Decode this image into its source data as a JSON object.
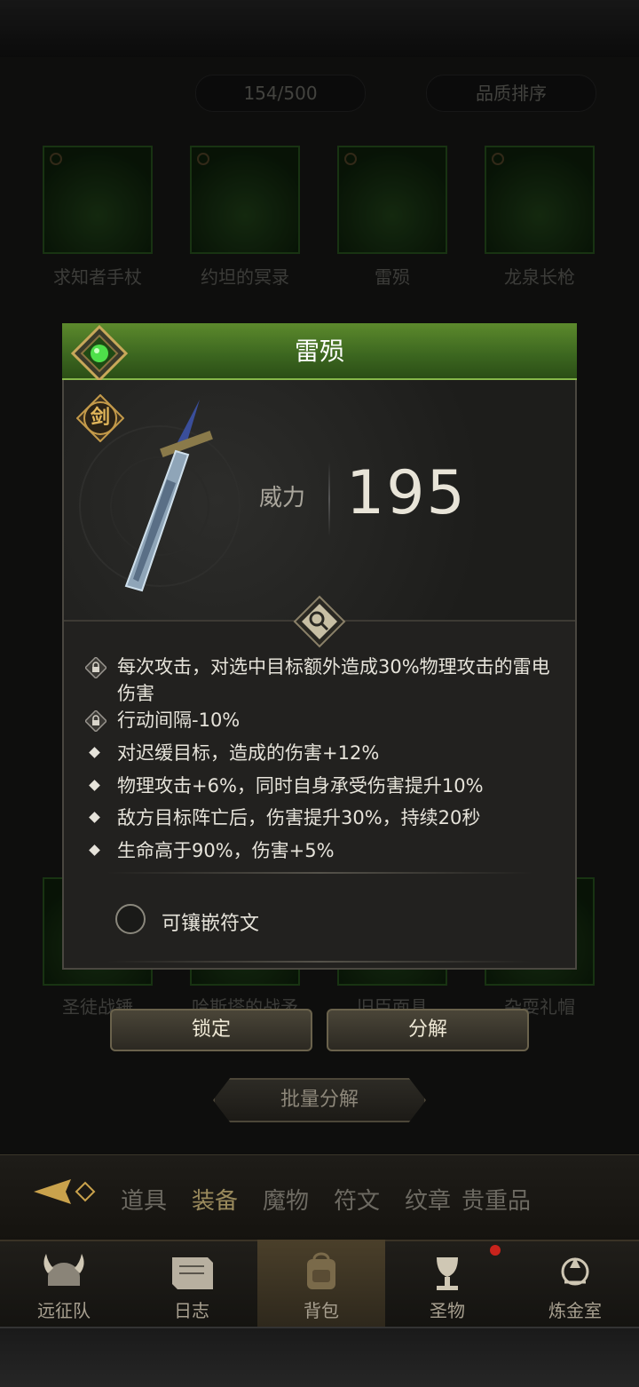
{
  "inventory": {
    "count": "154/500",
    "sort_label": "品质排序",
    "items": [
      {
        "name": "求知者手杖"
      },
      {
        "name": "约坦的冥录"
      },
      {
        "name": "雷殒"
      },
      {
        "name": "龙泉长枪"
      },
      {
        "name": "圣徒战锤"
      },
      {
        "name": "哈斯塔的战矛"
      },
      {
        "name": "旧臣面具"
      },
      {
        "name": "杂耍礼帽"
      }
    ]
  },
  "popup": {
    "title": "雷殒",
    "type_badge": "剑",
    "stat_label": "威力",
    "stat_value": "195",
    "attributes": [
      {
        "icon": "lock-icon",
        "text": "每次攻击，对选中目标额外造成30%物理攻击的雷电伤害"
      },
      {
        "icon": "lock-icon",
        "text": "行动间隔-10%"
      },
      {
        "icon": "diamond-bullet-icon",
        "text": "对迟缓目标，造成的伤害+12%"
      },
      {
        "icon": "diamond-bullet-icon",
        "text": "物理攻击+6%，同时自身承受伤害提升10%"
      },
      {
        "icon": "diamond-bullet-icon",
        "text": "敌方目标阵亡后，伤害提升30%，持续20秒"
      },
      {
        "icon": "diamond-bullet-icon",
        "text": "生命高于90%，伤害+5%"
      }
    ],
    "rune_label": "可镶嵌符文",
    "lock_button": "锁定",
    "decompose_button": "分解"
  },
  "bulk_decompose": "批量分解",
  "tabs": [
    {
      "label": "道具",
      "active": false
    },
    {
      "label": "装备",
      "active": true
    },
    {
      "label": "魔物",
      "active": false
    },
    {
      "label": "符文",
      "active": false
    },
    {
      "label": "纹章",
      "active": false
    },
    {
      "label": "贵重品",
      "active": false
    }
  ],
  "nav": [
    {
      "label": "远征队",
      "icon": "viking-helmet-icon",
      "active": false
    },
    {
      "label": "日志",
      "icon": "scroll-icon",
      "active": false
    },
    {
      "label": "背包",
      "icon": "backpack-icon",
      "active": true
    },
    {
      "label": "圣物",
      "icon": "chalice-icon",
      "active": false
    },
    {
      "label": "炼金室",
      "icon": "alchemy-icon",
      "active": false
    }
  ],
  "colors": {
    "header_green": "#4f7d26",
    "slot_green": "#2c5d22",
    "accent_gold": "#e2b65a",
    "notification_red": "#c8231c"
  }
}
